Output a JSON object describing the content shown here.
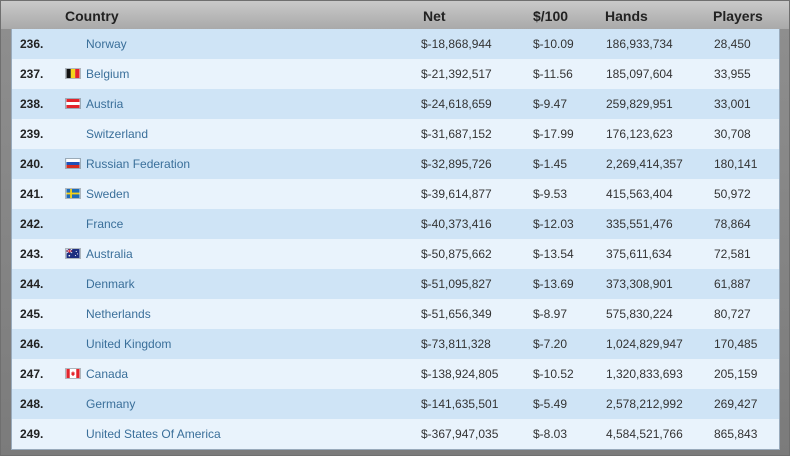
{
  "headers": {
    "country": "Country",
    "net": "Net",
    "per100": "$/100",
    "hands": "Hands",
    "players": "Players"
  },
  "rows": [
    {
      "rank": "236.",
      "country": "Norway",
      "flag": "",
      "net": "$-18,868,944",
      "per100": "$-10.09",
      "hands": "186,933,734",
      "players": "28,450"
    },
    {
      "rank": "237.",
      "country": "Belgium",
      "flag": "belgium",
      "net": "$-21,392,517",
      "per100": "$-11.56",
      "hands": "185,097,604",
      "players": "33,955"
    },
    {
      "rank": "238.",
      "country": "Austria",
      "flag": "austria",
      "net": "$-24,618,659",
      "per100": "$-9.47",
      "hands": "259,829,951",
      "players": "33,001"
    },
    {
      "rank": "239.",
      "country": "Switzerland",
      "flag": "",
      "net": "$-31,687,152",
      "per100": "$-17.99",
      "hands": "176,123,623",
      "players": "30,708"
    },
    {
      "rank": "240.",
      "country": "Russian Federation",
      "flag": "russia",
      "net": "$-32,895,726",
      "per100": "$-1.45",
      "hands": "2,269,414,357",
      "players": "180,141"
    },
    {
      "rank": "241.",
      "country": "Sweden",
      "flag": "sweden",
      "net": "$-39,614,877",
      "per100": "$-9.53",
      "hands": "415,563,404",
      "players": "50,972"
    },
    {
      "rank": "242.",
      "country": "France",
      "flag": "",
      "net": "$-40,373,416",
      "per100": "$-12.03",
      "hands": "335,551,476",
      "players": "78,864"
    },
    {
      "rank": "243.",
      "country": "Australia",
      "flag": "australia",
      "net": "$-50,875,662",
      "per100": "$-13.54",
      "hands": "375,611,634",
      "players": "72,581"
    },
    {
      "rank": "244.",
      "country": "Denmark",
      "flag": "",
      "net": "$-51,095,827",
      "per100": "$-13.69",
      "hands": "373,308,901",
      "players": "61,887"
    },
    {
      "rank": "245.",
      "country": "Netherlands",
      "flag": "",
      "net": "$-51,656,349",
      "per100": "$-8.97",
      "hands": "575,830,224",
      "players": "80,727"
    },
    {
      "rank": "246.",
      "country": "United Kingdom",
      "flag": "",
      "net": "$-73,811,328",
      "per100": "$-7.20",
      "hands": "1,024,829,947",
      "players": "170,485"
    },
    {
      "rank": "247.",
      "country": "Canada",
      "flag": "canada",
      "net": "$-138,924,805",
      "per100": "$-10.52",
      "hands": "1,320,833,693",
      "players": "205,159"
    },
    {
      "rank": "248.",
      "country": "Germany",
      "flag": "",
      "net": "$-141,635,501",
      "per100": "$-5.49",
      "hands": "2,578,212,992",
      "players": "269,427"
    },
    {
      "rank": "249.",
      "country": "United States Of America",
      "flag": "",
      "net": "$-367,947,035",
      "per100": "$-8.03",
      "hands": "4,584,521,766",
      "players": "865,843"
    }
  ]
}
